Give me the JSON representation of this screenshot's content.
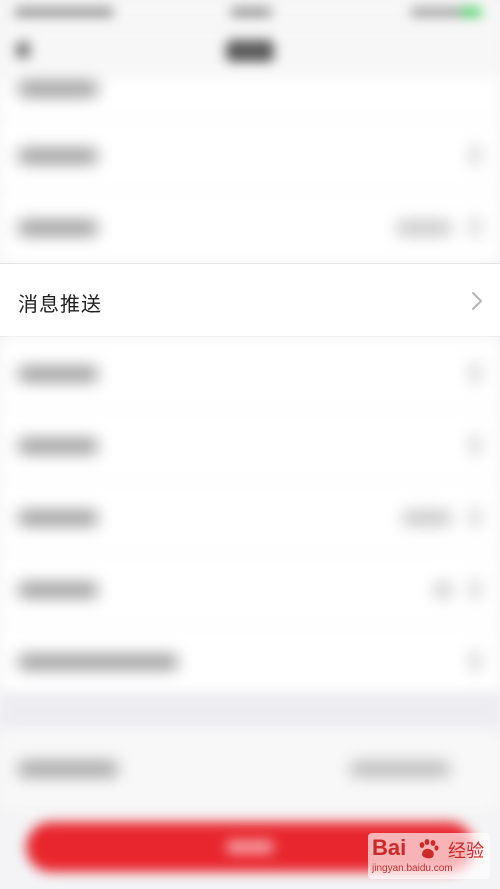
{
  "focus_item": {
    "label": "消息推送"
  },
  "watermark": {
    "brand": "Bai",
    "brand2": "经验",
    "url": "jingyan.baidu.com"
  }
}
